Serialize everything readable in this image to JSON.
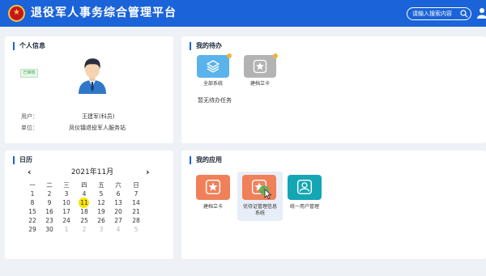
{
  "header": {
    "title": "退役军人事务综合管理平台",
    "search_placeholder": "请输入搜索内容",
    "colors": {
      "bar": "#1b63d8",
      "emblem_red": "#c6161d",
      "emblem_gold": "#f2c33c"
    }
  },
  "profile": {
    "title": "个人信息",
    "badge": "已审核",
    "user_label": "用户：",
    "user_value": "王建军(科员)",
    "unit_label": "单位：",
    "unit_value": "凤仪镇退役军人服务站"
  },
  "todo": {
    "title": "我的待办",
    "tiles": [
      {
        "label": "全部系统",
        "badge": "0",
        "icon": "layers-icon",
        "color": "#5ab3ea"
      },
      {
        "label": "建档立卡",
        "badge": "0",
        "icon": "star-icon",
        "color": "#b3b3b3"
      }
    ],
    "empty_text": "暂无待办任务"
  },
  "calendar": {
    "title": "日历",
    "month_label": "2021年11月",
    "prev": "‹",
    "next": "›",
    "weekdays": [
      "一",
      "二",
      "三",
      "四",
      "五",
      "六",
      "日"
    ],
    "weeks": [
      [
        "1",
        "2",
        "3",
        "4",
        "5",
        "6",
        "7"
      ],
      [
        "8",
        "9",
        "10",
        "11",
        "12",
        "13",
        "14"
      ],
      [
        "15",
        "16",
        "17",
        "18",
        "19",
        "20",
        "21"
      ],
      [
        "22",
        "23",
        "24",
        "25",
        "26",
        "27",
        "28"
      ],
      [
        "29",
        "30",
        "1",
        "2",
        "3",
        "4",
        "5"
      ]
    ],
    "today": "11",
    "today_color": "#f5e400"
  },
  "apps": {
    "title": "我的应用",
    "tiles": [
      {
        "label": "建档立卡",
        "icon": "star-icon",
        "color": "#f0805a"
      },
      {
        "label_line1": "优待证管理信息",
        "label_line2": "系统",
        "icon": "star-icon",
        "color": "#f0805a"
      },
      {
        "label": "统一用户管理",
        "icon": "user-badge-icon",
        "color": "#14a6b4"
      }
    ]
  }
}
